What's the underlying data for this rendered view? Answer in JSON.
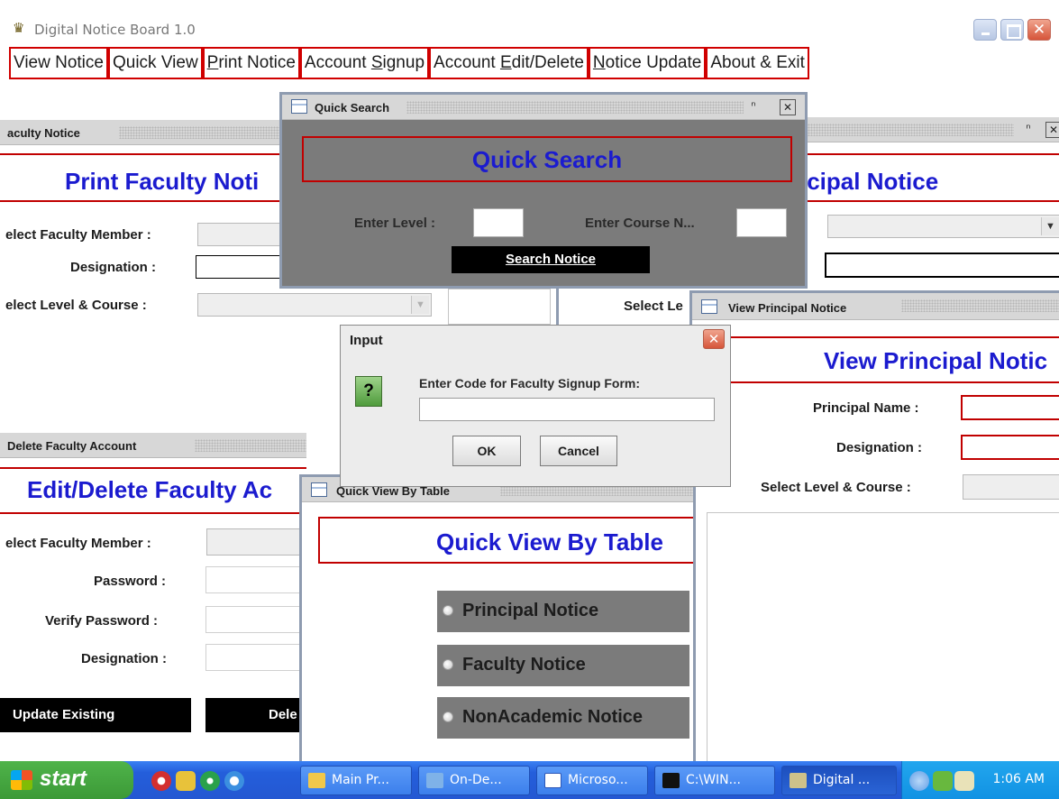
{
  "app": {
    "title": "Digital Notice Board 1.0",
    "icon": "app-emblem-icon",
    "controls": {
      "minimize": "_",
      "maximize": "□",
      "close": "✕"
    }
  },
  "menu": [
    {
      "label": "View Notice",
      "u": ""
    },
    {
      "label": "Quick View",
      "u": ""
    },
    {
      "label": "Print Notice",
      "u": "P"
    },
    {
      "label": "Account Signup",
      "u": "S"
    },
    {
      "label": "Account Edit/Delete",
      "u": "E"
    },
    {
      "label": "Notice Update",
      "u": "N"
    },
    {
      "label": "About & Exit",
      "u": ""
    }
  ],
  "faculty_notice": {
    "title": "aculty Notice",
    "heading": "Print Faculty Noti",
    "labels": {
      "member": "elect Faculty Member :",
      "designation": "Designation :",
      "level_course": "elect Level & Course :"
    }
  },
  "principal_notice_back": {
    "heading": "ıcipal Notice",
    "select_label": "Select Le"
  },
  "delete_account": {
    "title": "Delete Faculty Account",
    "heading": "Edit/Delete Faculty Ac",
    "labels": {
      "member": "elect Faculty Member :",
      "password": "Password :",
      "verify": "Verify Password :",
      "designation": "Designation :"
    },
    "buttons": {
      "update": "Update Existing",
      "delete": "Dele"
    }
  },
  "quick_search": {
    "title": "Quick Search",
    "heading": "Quick Search",
    "level_label": "Enter Level :",
    "course_label": "Enter Course N...",
    "search_button": "Search Notice"
  },
  "input_dialog": {
    "title": "Input",
    "message": "Enter Code for Faculty Signup Form:",
    "input_value": "",
    "ok": "OK",
    "cancel": "Cancel"
  },
  "view_principal": {
    "title": "View Principal Notice",
    "heading": "View Principal Notic",
    "labels": {
      "name": "Principal Name :",
      "designation": "Designation :",
      "level_course": "Select Level & Course :"
    }
  },
  "quick_view_table": {
    "title": "Quick View By Table",
    "heading": "Quick View By Table",
    "options": [
      "Principal Notice",
      "Faculty Notice",
      "NonAcademic Notice"
    ]
  },
  "taskbar": {
    "start": "start",
    "tasks": [
      {
        "label": "Main Pr...",
        "icon": "folder-icon"
      },
      {
        "label": "On-De...",
        "icon": "network-icon"
      },
      {
        "label": "Microso...",
        "icon": "word-icon"
      },
      {
        "label": "C:\\WIN...",
        "icon": "console-icon"
      },
      {
        "label": "Digital ...",
        "icon": "app-emblem-icon"
      }
    ],
    "clock": "1:06 AM"
  },
  "colors": {
    "heading_blue": "#1b1bcf",
    "border_red": "#c10000",
    "panel_gray": "#7b7b7b",
    "taskbar_blue": "#245edb"
  }
}
